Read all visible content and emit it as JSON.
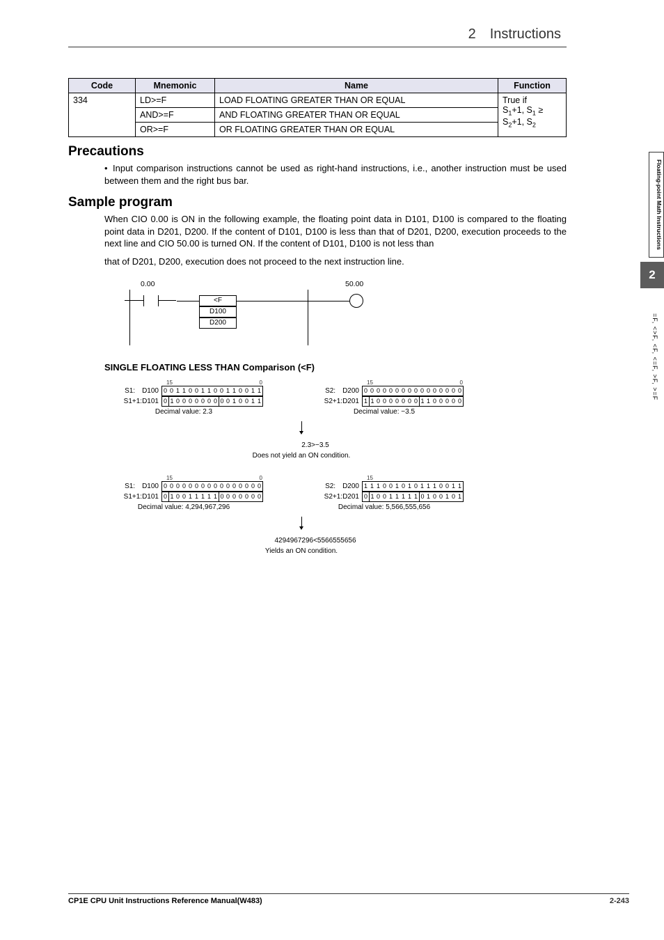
{
  "header": {
    "breadcrumb": "2 Instructions"
  },
  "table": {
    "headers": {
      "code": "Code",
      "mnemonic": "Mnemonic",
      "name": "Name",
      "function": "Function"
    },
    "code": "334",
    "rows": [
      {
        "mnemonic": "LD>=F",
        "name": "LOAD FLOATING GREATER THAN OR EQUAL"
      },
      {
        "mnemonic": "AND>=F",
        "name": "AND FLOATING GREATER THAN OR EQUAL"
      },
      {
        "mnemonic": "OR>=F",
        "name": "OR FLOATING GREATER THAN OR EQUAL"
      }
    ],
    "function_prefix": "True if",
    "function_line2a": "S",
    "function_line2b": "+1, S",
    "function_line2c": " ≥",
    "function_line3a": "S",
    "function_line3b": "+1, S"
  },
  "precautions": {
    "heading": "Precautions",
    "bullet": "Input comparison instructions cannot be used as right-hand instructions, i.e., another instruction must be used between them and the right bus bar."
  },
  "sample": {
    "heading": "Sample program",
    "para1": "When CIO 0.00 is ON in the following example, the floating point data in D101, D100 is compared to the floating point data in D201, D200. If the content of D101, D100 is less than that of D201, D200, execution proceeds to the next line and CIO 50.00 is turned ON. If the content of D101, D100 is not less than",
    "para2": "that of D201, D200, execution does not proceed to the next instruction line."
  },
  "ladder": {
    "contact_label": "0.00",
    "coil_label": "50.00",
    "box1": "<F",
    "box2": "D100",
    "box3": "D200"
  },
  "comp": {
    "title": "SINGLE FLOATING LESS THAN Comparison (<F)",
    "bitnum_hi": "15",
    "bitnum_lo": "0",
    "set1": {
      "s1_label": "S1: D100",
      "s1_bits": "0011001100110011",
      "s1p1_label": "S1+1:D101",
      "s1p1_bits": "0100000000010011",
      "s2_label": "S2: D200",
      "s2_bits": "0000000000000000",
      "s2p1_label": "S2+1:D201",
      "s2p1_bits": "1100000001100000",
      "dec1": "Decimal value: 2.3",
      "dec2": "Decimal value: −3.5",
      "mid": "2.3>−3.5",
      "cond": "Does not yield an ON condition."
    },
    "set2": {
      "s1_label": "S1: D100",
      "s1_bits": "0000000000000000",
      "s1p1_label": "S1+1:D101",
      "s1p1_bits": "0100111110000000",
      "s2_label": "S2: D200",
      "s2_bits": "1110010101110011",
      "s2p1_label": "S2+1:D201",
      "s2p1_bits": "0100111110100101",
      "dec1": "Decimal value: 4,294,967,296",
      "dec2": "Decimal value: 5,566,555,656",
      "mid": "4294967296<5566555656",
      "cond": "Yields an ON condition."
    }
  },
  "side": {
    "tab1": "Floating-point Math\nInstructions",
    "tab2": "2",
    "tab3": "=F, <>F, <F, <=F, >F, >=F"
  },
  "footer": {
    "manual": "CP1E CPU Unit Instructions Reference Manual(W483)",
    "page": "2-243"
  }
}
